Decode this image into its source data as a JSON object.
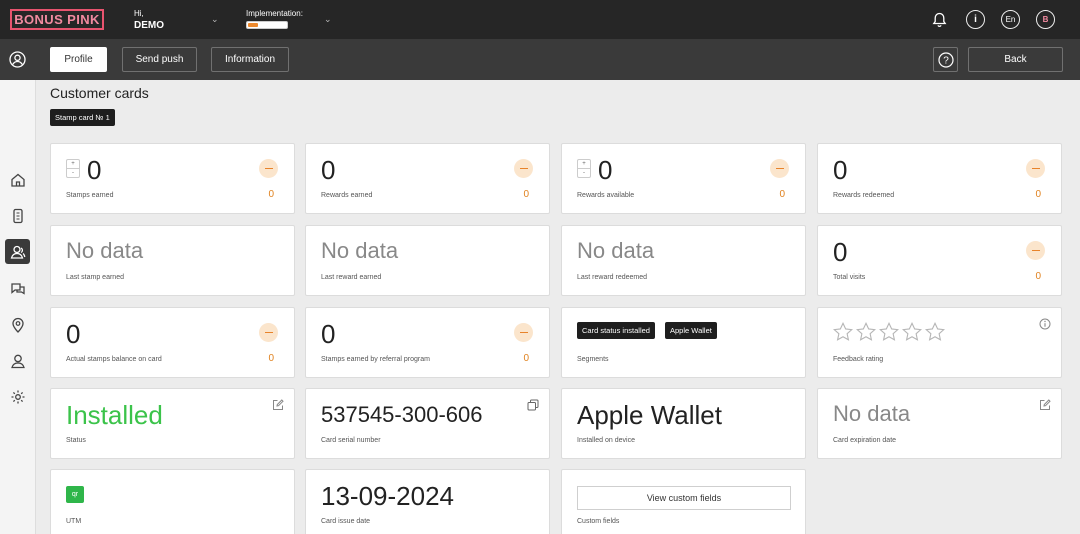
{
  "header": {
    "logo": "BONUS PINK",
    "greeting": "Hi,",
    "user": "DEMO",
    "implementation_label": "Implementation:",
    "implementation_progress": 0.25,
    "language": "En",
    "avatar_letter": "B"
  },
  "nav": {
    "profile": "Profile",
    "send_push": "Send push",
    "information": "Information",
    "back": "Back"
  },
  "page": {
    "title": "Customer cards",
    "card_tab": "Stamp card № 1"
  },
  "cards": {
    "stamps_earned": {
      "value": "0",
      "label": "Stamps earned",
      "side": "0"
    },
    "rewards_earned": {
      "value": "0",
      "label": "Rewards earned",
      "side": "0"
    },
    "rewards_available": {
      "value": "0",
      "label": "Rewards available",
      "side": "0"
    },
    "rewards_redeemed": {
      "value": "0",
      "label": "Rewards redeemed",
      "side": "0"
    },
    "last_stamp": {
      "value": "No data",
      "label": "Last stamp earned"
    },
    "last_reward": {
      "value": "No data",
      "label": "Last reward earned"
    },
    "last_redeemed": {
      "value": "No data",
      "label": "Last reward redeemed"
    },
    "total_visits": {
      "value": "0",
      "label": "Total visits",
      "side": "0"
    },
    "actual_stamps": {
      "value": "0",
      "label": "Actual stamps balance on card",
      "side": "0"
    },
    "referral_stamps": {
      "value": "0",
      "label": "Stamps earned by referral program",
      "side": "0"
    },
    "segments": {
      "label": "Segments",
      "tags": [
        "Card status installed",
        "Apple Wallet"
      ]
    },
    "feedback": {
      "label": "Feedback rating",
      "rating": 0,
      "max": 5
    },
    "status": {
      "value": "Installed",
      "label": "Status"
    },
    "serial": {
      "value": "537545-300-606",
      "label": "Card serial number"
    },
    "device": {
      "value": "Apple Wallet",
      "label": "Installed on device"
    },
    "expiration": {
      "value": "No data",
      "label": "Card expiration date"
    },
    "utm": {
      "badge": "qr",
      "label": "UTM"
    },
    "issue_date": {
      "value": "13-09-2024",
      "label": "Card issue date"
    },
    "custom_fields": {
      "button": "View custom fields",
      "label": "Custom fields"
    }
  },
  "stepper": {
    "plus": "+",
    "minus": "-"
  },
  "colors": {
    "accent_orange": "#e0821f",
    "installed_green": "#3bc34a",
    "brand_pink": "#e8546f"
  },
  "icons": {
    "bell": "bell-icon",
    "info": "info-icon",
    "help": "help-icon",
    "home": "home-icon",
    "mobile": "mobile-icon",
    "customers": "customers-icon",
    "chat": "chat-icon",
    "location": "location-icon",
    "user": "user-icon",
    "settings": "settings-icon"
  }
}
